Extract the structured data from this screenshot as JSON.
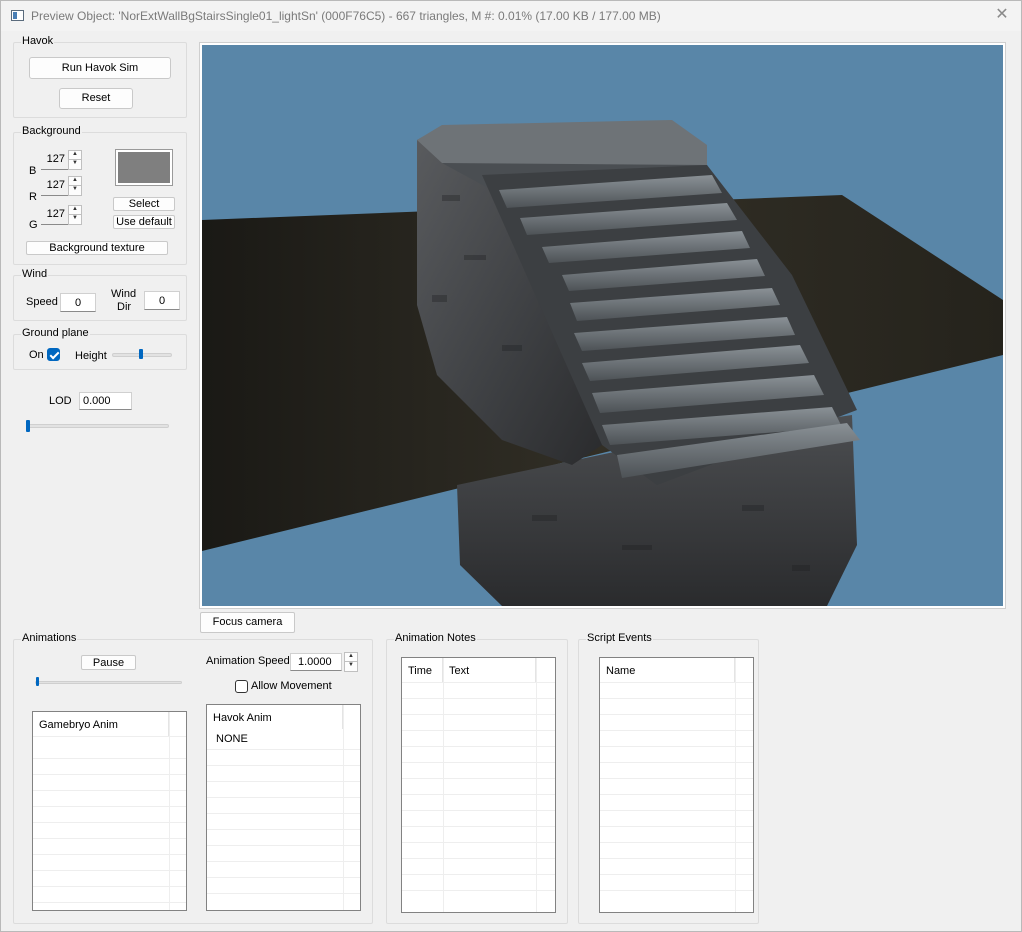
{
  "window": {
    "title": "Preview Object: 'NorExtWallBgStairsSingle01_lightSn' (000F76C5) - 667 triangles, M #: 0.01% (17.00 KB / 177.00 MB)",
    "close_glyph": "✕"
  },
  "havok": {
    "label": "Havok",
    "run_button": "Run Havok Sim",
    "reset_button": "Reset"
  },
  "background": {
    "label": "Background",
    "b_label": "B",
    "r_label": "R",
    "g_label": "G",
    "b_value": "127",
    "r_value": "127",
    "g_value": "127",
    "select_button": "Select",
    "default_button": "Use default",
    "texture_button": "Background texture",
    "swatch_color": "#7f7f7f"
  },
  "wind": {
    "label": "Wind",
    "speed_label": "Speed",
    "speed_value": "0",
    "dir_label_1": "Wind",
    "dir_label_2": "Dir",
    "dir_value": "0"
  },
  "ground": {
    "label": "Ground plane",
    "on_label": "On",
    "on_checked": true,
    "height_label": "Height"
  },
  "lod": {
    "label": "LOD",
    "value": "0.000"
  },
  "viewport": {
    "focus_button": "Focus camera",
    "sky_color": "#5986a8"
  },
  "animations": {
    "label": "Animations",
    "pause_button": "Pause",
    "speed_label": "Animation Speed",
    "speed_value": "1.0000",
    "allow_movement_label": "Allow Movement",
    "gamebryo_header": "Gamebryo Anim",
    "havok_header": "Havok Anim",
    "havok_items": [
      "NONE"
    ]
  },
  "notes": {
    "label": "Animation Notes",
    "col_time": "Time",
    "col_text": "Text"
  },
  "events": {
    "label": "Script Events",
    "col_name": "Name"
  }
}
